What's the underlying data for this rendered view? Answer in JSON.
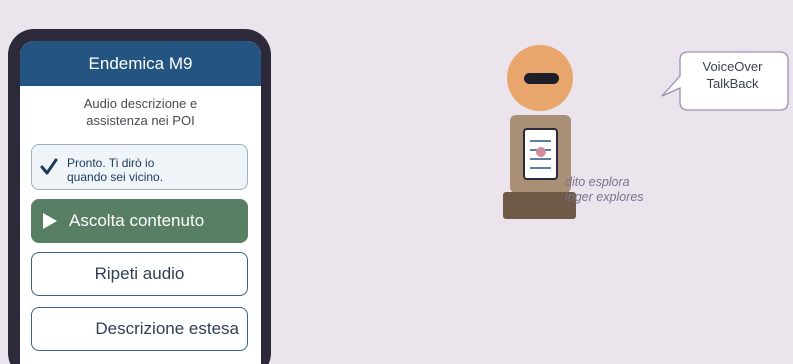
{
  "app": {
    "title": "Endemica M9",
    "subtitle_line1": "Audio descrizione e",
    "subtitle_line2": "assistenza nei POI",
    "status_line1": "Pronto. Ti dirò io",
    "status_line2": "quando sei vicino.",
    "primary_button": "Ascolta contenuto",
    "repeat_button": "Ripeti audio",
    "description_button": "Descrizione estesa"
  },
  "figure": {
    "caption_line1": "dito esplora",
    "caption_line2": "inger explores"
  },
  "bubble": {
    "line1": "VoiceOver",
    "line2": "TalkBack"
  },
  "colors": {
    "background": "#ebe4ec",
    "appbar": "#245582",
    "primary_button": "#587e64",
    "phone_frame": "#2c2a3a"
  },
  "icons": {
    "status": "check-icon",
    "primary": "play-icon",
    "figure_device": "phone-device-icon"
  }
}
